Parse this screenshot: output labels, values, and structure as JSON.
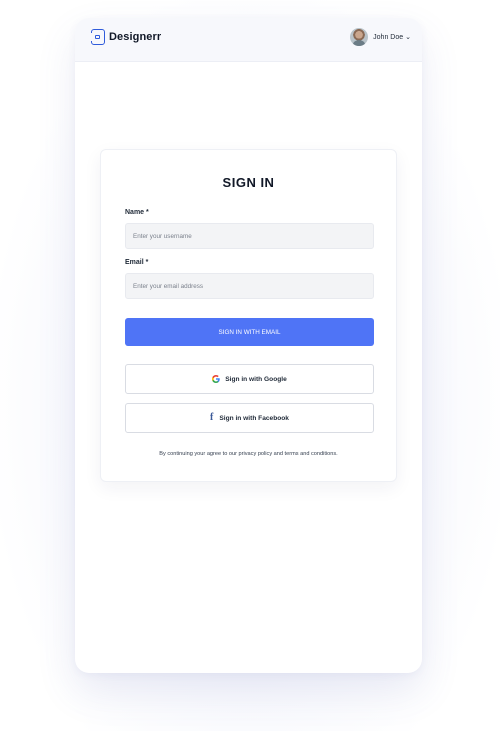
{
  "header": {
    "brand": "Designerr",
    "user_name": "John Doe"
  },
  "signin": {
    "title": "SIGN IN",
    "name_label": "Name *",
    "name_placeholder": "Enter your username",
    "email_label": "Email *",
    "email_placeholder": "Enter your email address",
    "email_button": "SIGN IN WITH EMAIL",
    "google_button": "Sign in with Google",
    "facebook_button": "Sign in with Facebook",
    "terms": "By continuing your agree to our privacy policy and terms and conditions."
  },
  "colors": {
    "accent": "#4f74f6",
    "brand": "#2f5bdb",
    "facebook": "#3b5998"
  },
  "icons": {
    "brand": "designerr-logo-icon",
    "dropdown": "chevron-down-icon",
    "google": "google-icon",
    "facebook": "facebook-icon"
  }
}
